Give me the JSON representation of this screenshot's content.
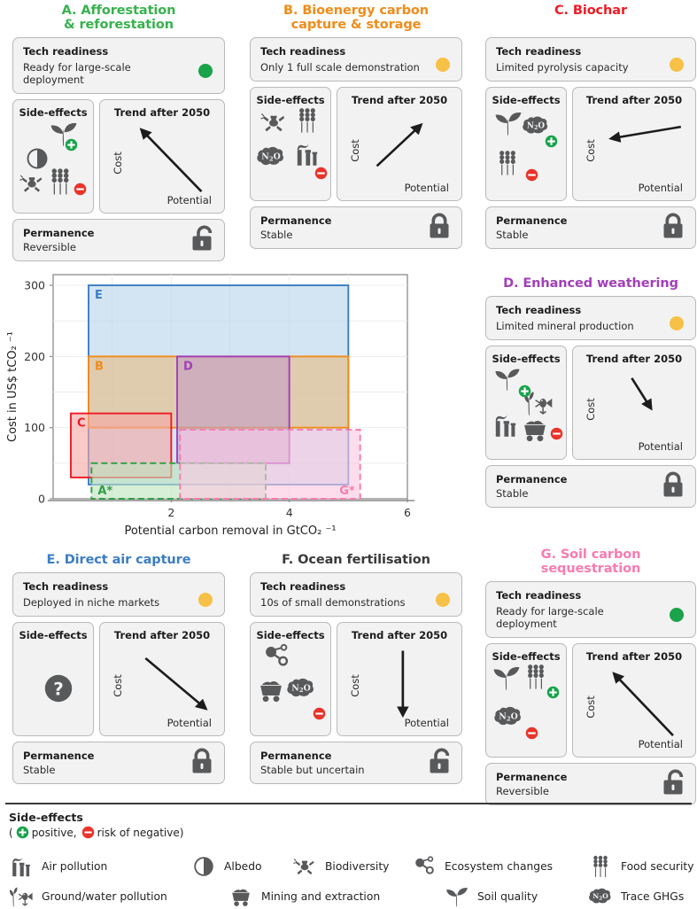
{
  "panels": [
    {
      "id": "A",
      "title_lines": [
        "A. Afforestation",
        "& reforestation"
      ],
      "color": "#37b24d",
      "tech": {
        "header": "Tech readiness",
        "value": "Ready for large-scale deployment",
        "status": "green"
      },
      "side": {
        "header": "Side-effects",
        "icons": [
          "soil-quality-icon",
          "albedo-icon",
          "biodiversity-icon",
          "food-security-icon"
        ],
        "badges": [
          "positive",
          "negative"
        ]
      },
      "trend": {
        "header": "Trend after 2050",
        "ylabel": "Cost",
        "xlabel": "Potential",
        "direction": "up-left"
      },
      "permanence": {
        "header": "Permanence",
        "value": "Reversible",
        "lock": "unlocked"
      }
    },
    {
      "id": "B",
      "title_lines": [
        "B. Bioenergy carbon",
        "capture & storage"
      ],
      "color": "#f08c1a",
      "tech": {
        "header": "Tech readiness",
        "value": "Only 1 full scale demonstration",
        "status": "amber"
      },
      "side": {
        "header": "Side-effects",
        "icons": [
          "biodiversity-icon",
          "food-security-icon",
          "trace-ghgs-icon",
          "air-pollution-icon"
        ],
        "badges": [
          "negative"
        ]
      },
      "trend": {
        "header": "Trend after 2050",
        "ylabel": "Cost",
        "xlabel": "Potential",
        "direction": "up-right"
      },
      "permanence": {
        "header": "Permanence",
        "value": "Stable",
        "lock": "locked"
      }
    },
    {
      "id": "C",
      "title_lines": [
        "C. Biochar"
      ],
      "color": "#ee1b24",
      "tech": {
        "header": "Tech readiness",
        "value": "Limited pyrolysis capacity",
        "status": "amber"
      },
      "side": {
        "header": "Side-effects",
        "icons": [
          "soil-quality-icon",
          "trace-ghgs-icon",
          "food-security-icon"
        ],
        "badges": [
          "positive",
          "negative"
        ]
      },
      "trend": {
        "header": "Trend after 2050",
        "ylabel": "Cost",
        "xlabel": "Potential",
        "direction": "left"
      },
      "permanence": {
        "header": "Permanence",
        "value": "Stable",
        "lock": "locked"
      }
    },
    {
      "id": "D",
      "title_lines": [
        "D. Enhanced weathering"
      ],
      "color": "#a23fb8",
      "tech": {
        "header": "Tech readiness",
        "value": "Limited mineral production",
        "status": "amber"
      },
      "side": {
        "header": "Side-effects",
        "icons": [
          "soil-quality-icon",
          "ground-water-pollution-icon",
          "air-pollution-icon",
          "mining-extraction-icon"
        ],
        "badges": [
          "positive",
          "negative"
        ]
      },
      "trend": {
        "header": "Trend after 2050",
        "ylabel": "Cost",
        "xlabel": "Potential",
        "direction": "down-short"
      },
      "permanence": {
        "header": "Permanence",
        "value": "Stable",
        "lock": "locked"
      }
    },
    {
      "id": "E",
      "title_lines": [
        "E. Direct air capture"
      ],
      "color": "#3b7dc4",
      "tech": {
        "header": "Tech readiness",
        "value": "Deployed in niche markets",
        "status": "amber"
      },
      "side": {
        "header": "Side-effects",
        "icons": [
          "question-mark-icon"
        ],
        "badges": []
      },
      "trend": {
        "header": "Trend after 2050",
        "ylabel": "Cost",
        "xlabel": "Potential",
        "direction": "down-right"
      },
      "permanence": {
        "header": "Permanence",
        "value": "Stable",
        "lock": "locked"
      }
    },
    {
      "id": "F",
      "title_lines": [
        "F. Ocean fertilisation"
      ],
      "color": "#3a3a3a",
      "tech": {
        "header": "Tech readiness",
        "value": "10s of small demonstrations",
        "status": "amber"
      },
      "side": {
        "header": "Side-effects",
        "icons": [
          "ecosystem-changes-icon",
          "mining-extraction-icon",
          "trace-ghgs-icon"
        ],
        "badges": [
          "negative"
        ]
      },
      "trend": {
        "header": "Trend after 2050",
        "ylabel": "Cost",
        "xlabel": "Potential",
        "direction": "down"
      },
      "permanence": {
        "header": "Permanence",
        "value": "Stable but uncertain",
        "lock": "unlocked"
      }
    },
    {
      "id": "G",
      "title_lines": [
        "G. Soil carbon",
        "sequestration"
      ],
      "color": "#f77bb0",
      "tech": {
        "header": "Tech readiness",
        "value": "Ready for large-scale deployment",
        "status": "green"
      },
      "side": {
        "header": "Side-effects",
        "icons": [
          "soil-quality-icon",
          "food-security-icon",
          "trace-ghgs-icon"
        ],
        "badges": [
          "positive",
          "negative"
        ]
      },
      "trend": {
        "header": "Trend after 2050",
        "ylabel": "Cost",
        "xlabel": "Potential",
        "direction": "up-left"
      },
      "permanence": {
        "header": "Permanence",
        "value": "Reversible",
        "lock": "unlocked"
      }
    }
  ],
  "chart_data": {
    "type": "scatter",
    "title": "",
    "xlabel": "Potential carbon removal in GtCO₂ ⁻¹",
    "ylabel": "Cost in US$ tCO₂ ⁻¹",
    "xlim": [
      0,
      6
    ],
    "ylim": [
      0,
      315
    ],
    "xticks": [
      2,
      4,
      6
    ],
    "xticklabels": [
      "2",
      "4",
      "6"
    ],
    "yticks": [
      0,
      100,
      200,
      300
    ],
    "yticklabels": [
      "0",
      "100",
      "200",
      "300"
    ],
    "grid": true,
    "legend_position": "inline-labels",
    "boxes": [
      {
        "label": "E",
        "name": "Direct air capture",
        "x0": 0.6,
        "x1": 5.0,
        "y0": 20,
        "y1": 300,
        "color": "#3b7dc4",
        "fill": "#b8d4ea",
        "dashed": false,
        "label_pos": "top-left"
      },
      {
        "label": "B",
        "name": "Bioenergy carbon capture & storage",
        "x0": 0.6,
        "x1": 5.0,
        "y0": 100,
        "y1": 200,
        "color": "#f08c1a",
        "fill": "#e6bc85",
        "dashed": false,
        "label_pos": "top-left"
      },
      {
        "label": "D",
        "name": "Enhanced weathering",
        "x0": 2.1,
        "x1": 4.0,
        "y0": 50,
        "y1": 200,
        "color": "#a23fb8",
        "fill": "#c49ec4",
        "dashed": false,
        "label_pos": "top-left"
      },
      {
        "label": "C",
        "name": "Biochar",
        "x0": 0.3,
        "x1": 2.0,
        "y0": 30,
        "y1": 120,
        "color": "#ee1b24",
        "fill": "#f6a8a4",
        "dashed": false,
        "label_pos": "top-left"
      },
      {
        "label": "A*",
        "name": "Afforestation & reforestation",
        "x0": 0.65,
        "x1": 3.6,
        "y0": 0,
        "y1": 50,
        "color": "#2f9e44",
        "fill": "#bfe3bf",
        "dashed": true,
        "label_pos": "bottom-left"
      },
      {
        "label": "G*",
        "name": "Soil carbon sequestration",
        "x0": 2.15,
        "x1": 5.2,
        "y0": 0,
        "y1": 97,
        "color": "#f77bb0",
        "fill": "#fcc8e0",
        "dashed": true,
        "label_pos": "bottom-right"
      }
    ]
  },
  "legend": {
    "title": "Side-effects",
    "subtitle_open": "(",
    "subtitle_positive": "positive,",
    "subtitle_negative": "risk of negative)",
    "items": [
      {
        "icon": "air-pollution-icon",
        "label": "Air pollution"
      },
      {
        "icon": "albedo-icon",
        "label": "Albedo"
      },
      {
        "icon": "biodiversity-icon",
        "label": "Biodiversity"
      },
      {
        "icon": "ecosystem-changes-icon",
        "label": "Ecosystem changes"
      },
      {
        "icon": "food-security-icon",
        "label": "Food security"
      },
      {
        "icon": "ground-water-pollution-icon",
        "label": "Ground/water pollution"
      },
      {
        "icon": "mining-extraction-icon",
        "label": "Mining and extraction"
      },
      {
        "icon": "soil-quality-icon",
        "label": "Soil quality"
      },
      {
        "icon": "trace-ghgs-icon",
        "label": "Trace GHGs"
      }
    ]
  },
  "colors": {
    "green_status": "#1aa34a",
    "amber_status": "#f7c046",
    "positive_badge": "#17a34a",
    "negative_badge": "#e8342a",
    "icon_grey": "#58595b"
  }
}
